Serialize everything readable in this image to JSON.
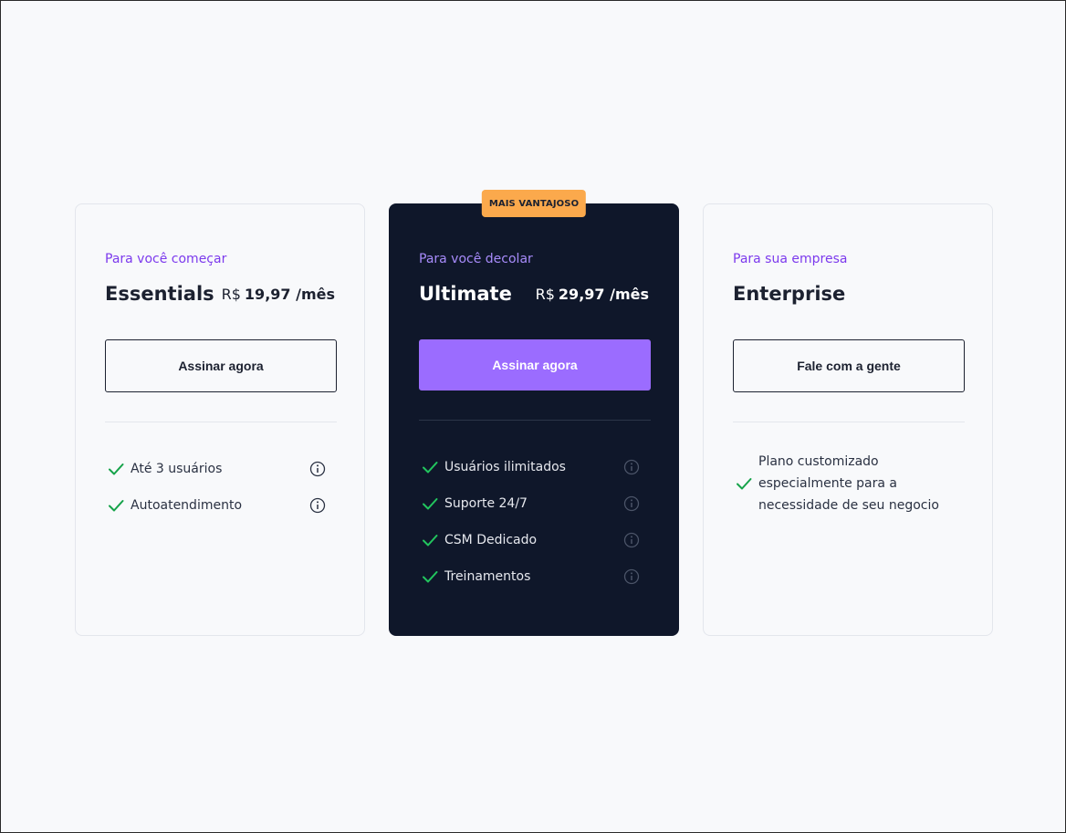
{
  "colors": {
    "accent": "#7c3aed",
    "accent_button": "#9b6cff",
    "badge": "#fba94c",
    "dark_card": "#0f172a",
    "check": "#16a34a"
  },
  "plans": {
    "essentials": {
      "tagline": "Para você começar",
      "name": "Essentials",
      "currency": "R$",
      "amount": "19,97 /mês",
      "cta": "Assinar agora",
      "features": [
        {
          "label": "Até 3 usuários",
          "icon": "info-icon"
        },
        {
          "label": "Autoatendimento",
          "icon": "info-icon"
        }
      ]
    },
    "ultimate": {
      "badge": "MAIS VANTAJOSO",
      "tagline": "Para você decolar",
      "name": "Ultimate",
      "currency": "R$",
      "amount": "29,97 /mês",
      "cta": "Assinar agora",
      "features": [
        {
          "label": "Usuários ilimitados",
          "icon": "info-icon"
        },
        {
          "label": "Suporte 24/7",
          "icon": "info-icon"
        },
        {
          "label": "CSM Dedicado",
          "icon": "info-icon"
        },
        {
          "label": "Treinamentos",
          "icon": "info-icon"
        }
      ]
    },
    "enterprise": {
      "tagline": "Para sua empresa",
      "name": "Enterprise",
      "cta": "Fale com a gente",
      "features": [
        {
          "label": "Plano customizado\nespecialmente para a\nnecessidade de seu negocio",
          "icon": "check-icon"
        }
      ]
    }
  }
}
